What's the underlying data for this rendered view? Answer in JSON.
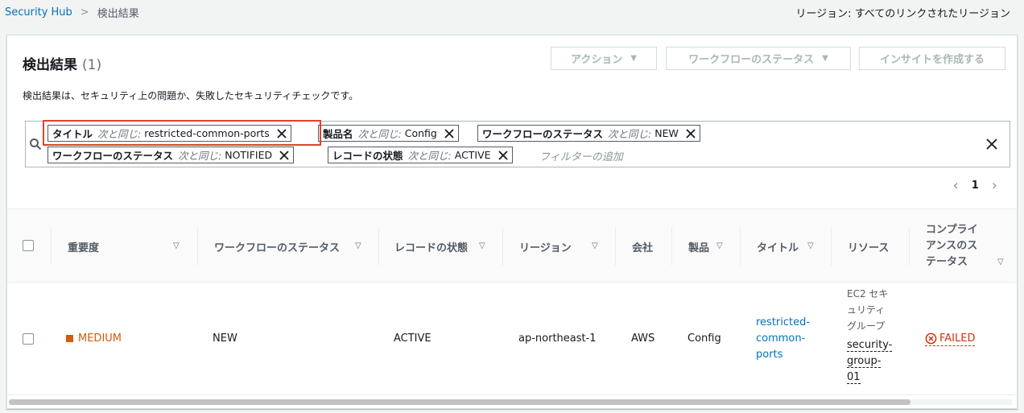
{
  "breadcrumb": {
    "root": "Security Hub",
    "separator": ">",
    "current": "検出結果"
  },
  "region": {
    "text": "リージョン: すべてのリンクされたリージョン"
  },
  "panel": {
    "title": "検出結果",
    "count": "(1)",
    "description": "検出結果は、セキュリティ上の問題か、失敗したセキュリティチェックです。",
    "buttons": {
      "actions": "アクション",
      "workflow_status": "ワークフローのステータス",
      "create_insight": "インサイトを作成する"
    }
  },
  "filters": {
    "op": "次と同じ:",
    "tokens": [
      {
        "key": "タイトル",
        "value": "restricted-common-ports"
      },
      {
        "key": "製品名",
        "value": "Config"
      },
      {
        "key": "ワークフローのステータス",
        "value": "NEW"
      },
      {
        "key": "ワークフローのステータス",
        "value": "NOTIFIED"
      },
      {
        "key": "レコードの状態",
        "value": "ACTIVE"
      }
    ],
    "placeholder": "フィルターの追加"
  },
  "pagination": {
    "page": "1"
  },
  "table": {
    "columns": {
      "severity": "重要度",
      "workflow": "ワークフローのステータス",
      "record_state": "レコードの状態",
      "region": "リージョン",
      "company": "会社",
      "product": "製品",
      "title": "タイトル",
      "resource": "リソース",
      "compliance": [
        "コンプライ",
        "アンスのス",
        "テータス"
      ]
    },
    "rows": [
      {
        "severity": "MEDIUM",
        "workflow": "NEW",
        "record_state": "ACTIVE",
        "region": "ap-northeast-1",
        "company": "AWS",
        "product": "Config",
        "title_lines": [
          "restricted-",
          "common-",
          "ports"
        ],
        "resource_type_lines": [
          "EC2 セキ",
          "ュリティ",
          "グループ"
        ],
        "resource_id_lines": [
          "security-",
          "group-",
          "01"
        ],
        "compliance": "FAILED"
      }
    ]
  },
  "colors": {
    "link": "#0073bb",
    "medium": "#d45b07",
    "failed": "#d13212",
    "highlight": "#e0422c"
  }
}
